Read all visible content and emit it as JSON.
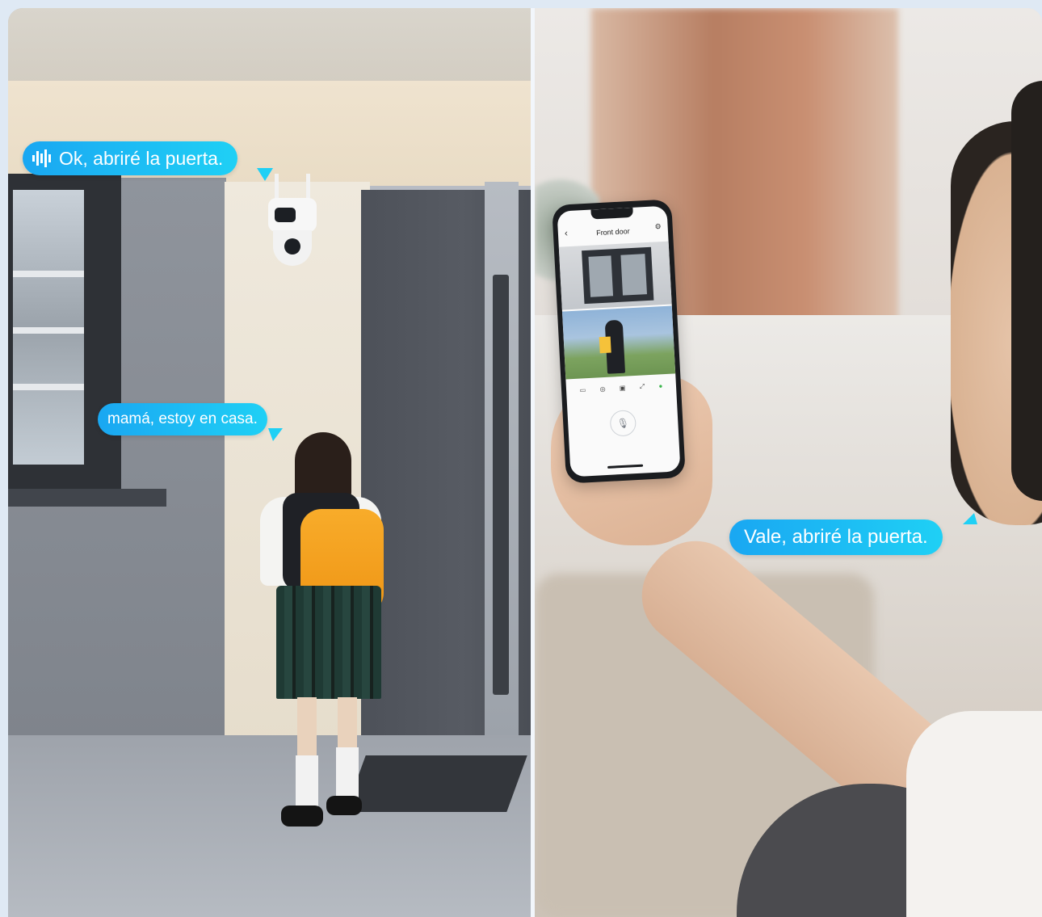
{
  "bubbles": {
    "camera_reply": "Ok, abriré la puerta.",
    "girl": "mamá, estoy en casa.",
    "mother": "Vale, abriré la puerta."
  },
  "phone": {
    "app_title": "Front door"
  },
  "colors": {
    "bubble_start": "#1aa7f2",
    "bubble_end": "#1fd0f5",
    "door": "#4f535b",
    "backpack": "#f6a21c"
  },
  "icons": [
    "sound-wave-icon",
    "microphone-icon",
    "back-arrow-icon",
    "settings-icon"
  ]
}
